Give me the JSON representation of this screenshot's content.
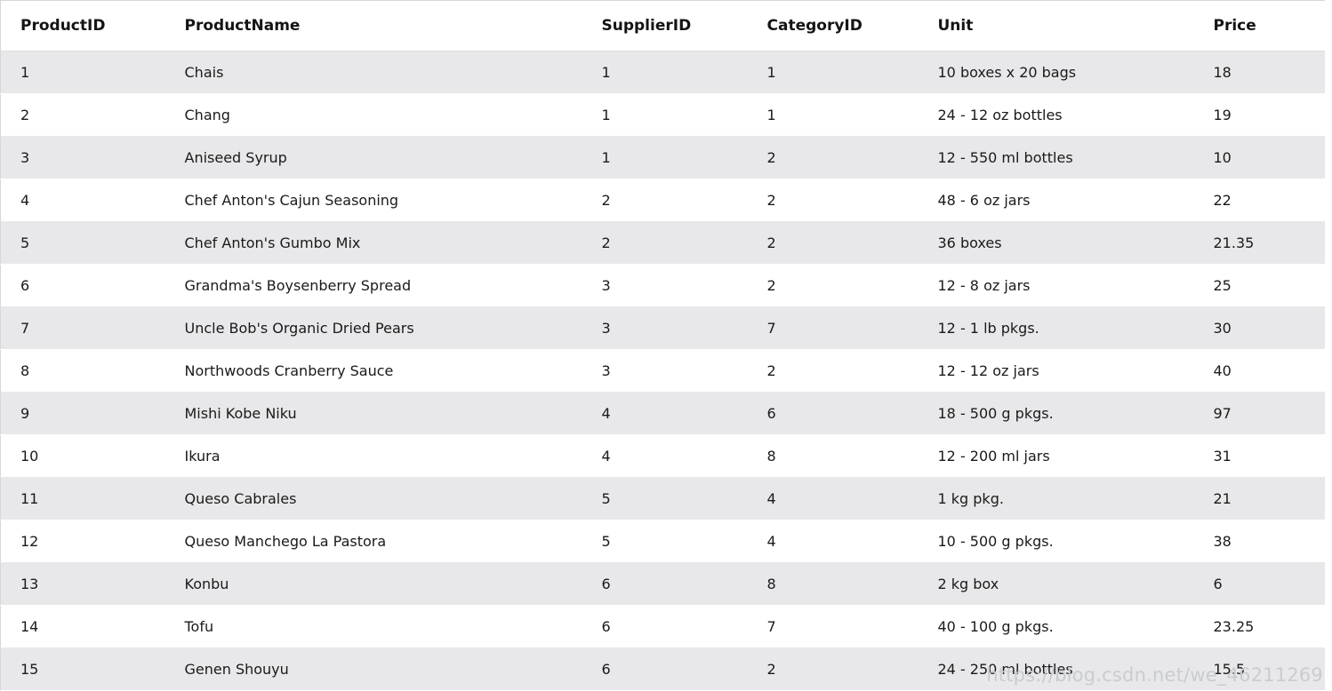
{
  "table": {
    "columns": [
      {
        "key": "ProductID",
        "label": "ProductID"
      },
      {
        "key": "ProductName",
        "label": "ProductName"
      },
      {
        "key": "SupplierID",
        "label": "SupplierID"
      },
      {
        "key": "CategoryID",
        "label": "CategoryID"
      },
      {
        "key": "Unit",
        "label": "Unit"
      },
      {
        "key": "Price",
        "label": "Price"
      }
    ],
    "rows": [
      {
        "ProductID": "1",
        "ProductName": "Chais",
        "SupplierID": "1",
        "CategoryID": "1",
        "Unit": "10 boxes x 20 bags",
        "Price": "18"
      },
      {
        "ProductID": "2",
        "ProductName": "Chang",
        "SupplierID": "1",
        "CategoryID": "1",
        "Unit": "24 - 12 oz bottles",
        "Price": "19"
      },
      {
        "ProductID": "3",
        "ProductName": "Aniseed Syrup",
        "SupplierID": "1",
        "CategoryID": "2",
        "Unit": "12 - 550 ml bottles",
        "Price": "10"
      },
      {
        "ProductID": "4",
        "ProductName": "Chef Anton's Cajun Seasoning",
        "SupplierID": "2",
        "CategoryID": "2",
        "Unit": "48 - 6 oz jars",
        "Price": "22"
      },
      {
        "ProductID": "5",
        "ProductName": "Chef Anton's Gumbo Mix",
        "SupplierID": "2",
        "CategoryID": "2",
        "Unit": "36 boxes",
        "Price": "21.35"
      },
      {
        "ProductID": "6",
        "ProductName": "Grandma's Boysenberry Spread",
        "SupplierID": "3",
        "CategoryID": "2",
        "Unit": "12 - 8 oz jars",
        "Price": "25"
      },
      {
        "ProductID": "7",
        "ProductName": "Uncle Bob's Organic Dried Pears",
        "SupplierID": "3",
        "CategoryID": "7",
        "Unit": "12 - 1 lb pkgs.",
        "Price": "30"
      },
      {
        "ProductID": "8",
        "ProductName": "Northwoods Cranberry Sauce",
        "SupplierID": "3",
        "CategoryID": "2",
        "Unit": "12 - 12 oz jars",
        "Price": "40"
      },
      {
        "ProductID": "9",
        "ProductName": "Mishi Kobe Niku",
        "SupplierID": "4",
        "CategoryID": "6",
        "Unit": "18 - 500 g pkgs.",
        "Price": "97"
      },
      {
        "ProductID": "10",
        "ProductName": "Ikura",
        "SupplierID": "4",
        "CategoryID": "8",
        "Unit": "12 - 200 ml jars",
        "Price": "31"
      },
      {
        "ProductID": "11",
        "ProductName": "Queso Cabrales",
        "SupplierID": "5",
        "CategoryID": "4",
        "Unit": "1 kg pkg.",
        "Price": "21"
      },
      {
        "ProductID": "12",
        "ProductName": "Queso Manchego La Pastora",
        "SupplierID": "5",
        "CategoryID": "4",
        "Unit": "10 - 500 g pkgs.",
        "Price": "38"
      },
      {
        "ProductID": "13",
        "ProductName": "Konbu",
        "SupplierID": "6",
        "CategoryID": "8",
        "Unit": "2 kg box",
        "Price": "6"
      },
      {
        "ProductID": "14",
        "ProductName": "Tofu",
        "SupplierID": "6",
        "CategoryID": "7",
        "Unit": "40 - 100 g pkgs.",
        "Price": "23.25"
      },
      {
        "ProductID": "15",
        "ProductName": "Genen Shouyu",
        "SupplierID": "6",
        "CategoryID": "2",
        "Unit": "24 - 250 ml bottles",
        "Price": "15.5"
      }
    ]
  },
  "watermark": {
    "text": "https://blog.csdn.net/we_46211269"
  },
  "colors": {
    "row_stripe": "#e8e8ea",
    "row_plain": "#ffffff",
    "border": "#d6d6d8",
    "text": "#1a1a1a",
    "header_text": "#141414",
    "watermark": "#c9ccd1"
  }
}
